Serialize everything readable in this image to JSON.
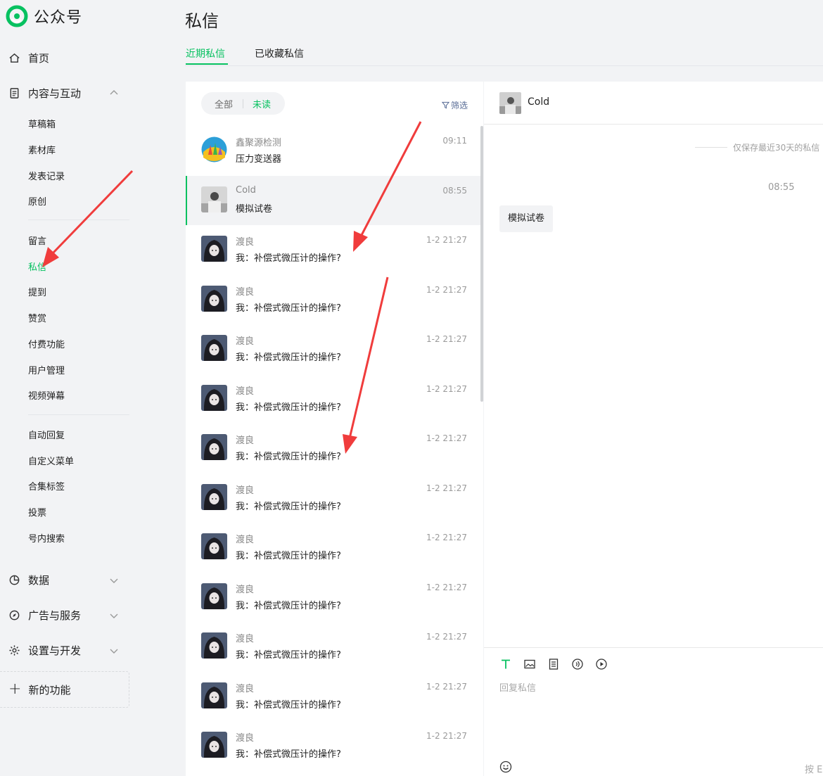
{
  "brand": {
    "name": "公众号"
  },
  "sidebar": {
    "home": "首页",
    "content_interaction": "内容与互动",
    "content_items": [
      "草稿箱",
      "素材库",
      "发表记录",
      "原创"
    ],
    "interaction_items": [
      "留言",
      "私信",
      "提到",
      "赞赏",
      "付费功能",
      "用户管理",
      "视频弹幕"
    ],
    "feature_items": [
      "自动回复",
      "自定义菜单",
      "合集标签",
      "投票",
      "号内搜索"
    ],
    "data": "数据",
    "ads_services": "广告与服务",
    "settings_dev": "设置与开发",
    "new_features": "新的功能",
    "active_item": "私信"
  },
  "page": {
    "title": "私信"
  },
  "tabs": [
    {
      "label": "近期私信",
      "active": true
    },
    {
      "label": "已收藏私信",
      "active": false
    }
  ],
  "list": {
    "filter_all": "全部",
    "filter_unread": "未读",
    "filter_button": "筛选",
    "conversations": [
      {
        "name": "鑫聚源检测",
        "preview": "压力变送器",
        "time": "09:11",
        "avatar": "colorful-logo"
      },
      {
        "name": "Cold",
        "preview": "模拟试卷",
        "time": "08:55",
        "avatar": "photo-gray",
        "active": true
      },
      {
        "name": "渡良",
        "preview": "我：补偿式微压计的操作?",
        "time": "1-2 21:27",
        "avatar": "anime-dark"
      },
      {
        "name": "渡良",
        "preview": "我：补偿式微压计的操作?",
        "time": "1-2 21:27",
        "avatar": "anime-dark"
      },
      {
        "name": "渡良",
        "preview": "我：补偿式微压计的操作?",
        "time": "1-2 21:27",
        "avatar": "anime-dark"
      },
      {
        "name": "渡良",
        "preview": "我：补偿式微压计的操作?",
        "time": "1-2 21:27",
        "avatar": "anime-dark"
      },
      {
        "name": "渡良",
        "preview": "我：补偿式微压计的操作?",
        "time": "1-2 21:27",
        "avatar": "anime-dark"
      },
      {
        "name": "渡良",
        "preview": "我：补偿式微压计的操作?",
        "time": "1-2 21:27",
        "avatar": "anime-dark"
      },
      {
        "name": "渡良",
        "preview": "我：补偿式微压计的操作?",
        "time": "1-2 21:27",
        "avatar": "anime-dark"
      },
      {
        "name": "渡良",
        "preview": "我：补偿式微压计的操作?",
        "time": "1-2 21:27",
        "avatar": "anime-dark"
      },
      {
        "name": "渡良",
        "preview": "我：补偿式微压计的操作?",
        "time": "1-2 21:27",
        "avatar": "anime-dark"
      },
      {
        "name": "渡良",
        "preview": "我：补偿式微压计的操作?",
        "time": "1-2 21:27",
        "avatar": "anime-dark"
      },
      {
        "name": "渡良",
        "preview": "我：补偿式微压计的操作?",
        "time": "1-2 21:27",
        "avatar": "anime-dark"
      }
    ]
  },
  "chat": {
    "contact_name": "Cold",
    "notice": "仅保存最近30天的私信",
    "message_time": "08:55",
    "message_text": "模拟试卷",
    "reply_placeholder": "回复私信",
    "send_hint": "按 Enter 发送"
  },
  "toolbar_icons": [
    "text-icon",
    "image-icon",
    "document-icon",
    "audio-icon",
    "video-icon"
  ],
  "colors": {
    "accent": "#07c160",
    "link": "#576b95",
    "annotation": "#f03c3c"
  }
}
